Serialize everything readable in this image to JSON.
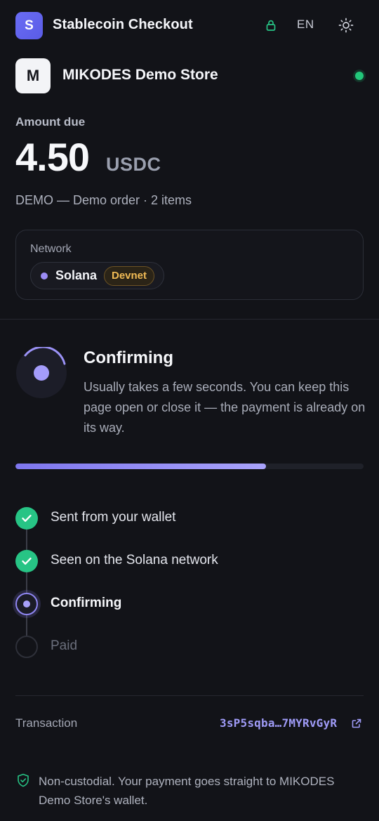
{
  "header": {
    "logo_letter": "S",
    "title": "Stablecoin Checkout",
    "language": "EN",
    "icons": [
      "lock-icon",
      "sun-icon"
    ]
  },
  "merchant": {
    "logo_letter": "M",
    "name": "MIKODES Demo Store",
    "online_color": "#22c77a"
  },
  "payment": {
    "amount_label": "Amount due",
    "amount": "4.50",
    "currency": "USDC",
    "order_line": "DEMO — Demo order · 2 items"
  },
  "network": {
    "label": "Network",
    "name": "Solana",
    "badge": "Devnet"
  },
  "status": {
    "title": "Confirming",
    "description": "Usually takes a few seconds. You can keep this page open or close it — the payment is already on its way.",
    "progress_percent": 72
  },
  "steps": [
    {
      "label": "Sent from your wallet",
      "state": "done"
    },
    {
      "label": "Seen on the Solana network",
      "state": "done"
    },
    {
      "label": "Confirming",
      "state": "active"
    },
    {
      "label": "Paid",
      "state": "pending"
    }
  ],
  "transaction": {
    "label": "Transaction",
    "hash": "3sP5sqba…7MYRvGyR"
  },
  "footer": {
    "note": "Non-custodial. Your payment goes straight to MIKODES Demo Store's wallet."
  },
  "colors": {
    "accent": "#8f86f2",
    "success": "#27c485",
    "warning": "#f1bb55",
    "background": "#121318"
  }
}
